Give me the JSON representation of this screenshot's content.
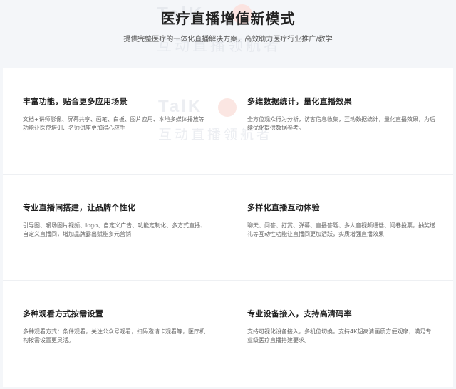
{
  "header": {
    "title": "医疗直播增值新模式",
    "subtitle": "提供完整医疗的一体化直播解决方案，高效助力医疗行业推广/教学",
    "watermark_logo": "TalK",
    "watermark_text": "互动直播领航者"
  },
  "features": [
    {
      "title": "丰富功能，贴合更多应用场景",
      "description": "文档+讲师影像、屏幕共享、画笔、白板、图片应用、本地多媒体播放等功能让医疗培训、名师讲座更加得心应手"
    },
    {
      "title": "多维数据统计，量化直播效果",
      "description": "全方位观众行为分析，访客信息收集，互动数据统计，量化直播效果，为后续优化提供数据参考。"
    },
    {
      "title": "专业直播间搭建，让品牌个性化",
      "description": "引导图、暖场图片视频、logo、自定义广告、功能定制化、多方式直播、自定义直播间，增加品牌露出赋能多元营销"
    },
    {
      "title": "多样化直播互动体验",
      "description": "聊天、问答、打赏、弹幕、直播答题、多人音视频通话、问卷投票，抽奖送礼等互动性功能让直播间更加活跃，实质增强直播效果"
    },
    {
      "title": "多种观看方式按需设置",
      "description": "多种观看方式：条件观看，关注公众号观看，扫码邀请卡观看等，医疗机构按需设置更灵活。"
    },
    {
      "title": "专业设备接入，支持高清码率",
      "description": "支持可视化设备接入，多机位切换。支持4K超高清画质方便观摩，满足专业级医疗直播搭建要求。"
    }
  ]
}
